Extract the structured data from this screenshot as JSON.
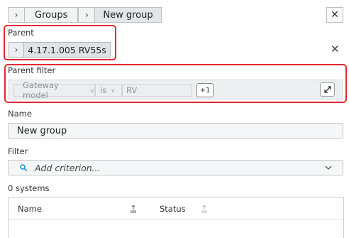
{
  "breadcrumb": {
    "items": [
      "Groups",
      "New group"
    ]
  },
  "parent": {
    "label": "Parent",
    "value": "4.17.1.005 RV55s"
  },
  "parent_filter": {
    "label": "Parent filter",
    "field": "Gateway model",
    "operator": "is",
    "value": "RV",
    "extra_count": "+1"
  },
  "name": {
    "label": "Name",
    "value": "New group"
  },
  "filter": {
    "label": "Filter",
    "placeholder": "Add criterion..."
  },
  "systems": {
    "count_label": "0 systems",
    "columns": [
      "Name",
      "Status"
    ]
  },
  "icons": {
    "close": "close-icon",
    "clear": "clear-icon",
    "expand": "expand-icon",
    "search": "search-icon",
    "chevron": "chevron-down-icon",
    "sort": "sort-icon"
  },
  "colors": {
    "highlight": "#e02a30",
    "accent": "#1a8fd6"
  }
}
